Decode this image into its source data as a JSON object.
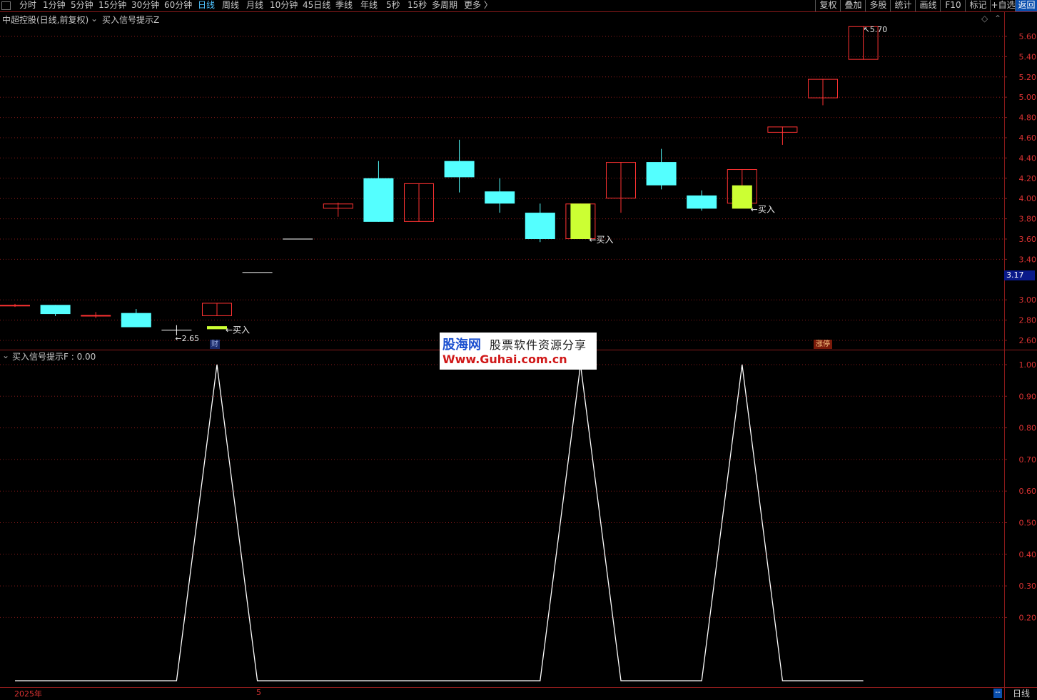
{
  "toolbar": {
    "periods": [
      {
        "label": "分时",
        "x": 27
      },
      {
        "label": "1分钟",
        "x": 60
      },
      {
        "label": "5分钟",
        "x": 99
      },
      {
        "label": "15分钟",
        "x": 138
      },
      {
        "label": "30分钟",
        "x": 184
      },
      {
        "label": "60分钟",
        "x": 230
      },
      {
        "label": "日线",
        "x": 277,
        "active": true
      },
      {
        "label": "周线",
        "x": 311
      },
      {
        "label": "月线",
        "x": 345
      },
      {
        "label": "10分钟",
        "x": 378
      },
      {
        "label": "45日线",
        "x": 424
      },
      {
        "label": "季线",
        "x": 470
      },
      {
        "label": "年线",
        "x": 505
      },
      {
        "label": "5秒",
        "x": 541
      },
      {
        "label": "15秒",
        "x": 571
      },
      {
        "label": "多周期",
        "x": 605
      },
      {
        "label": "更多 〉",
        "x": 650
      }
    ],
    "right_buttons": [
      "复权",
      "叠加",
      "多股",
      "统计",
      "画线",
      "F10",
      "标记",
      "+自选",
      "返回"
    ]
  },
  "main_chart": {
    "stock_title": "中超控股(日线,前复权)",
    "indicator_title": "买入信号提示Z",
    "y_ticks": [
      "5.60",
      "5.40",
      "5.20",
      "5.00",
      "4.80",
      "4.60",
      "4.40",
      "4.20",
      "4.00",
      "3.80",
      "3.60",
      "3.40",
      "3.00",
      "2.80",
      "2.60"
    ],
    "y_tick_values": [
      5.6,
      5.4,
      5.2,
      5.0,
      4.8,
      4.6,
      4.4,
      4.2,
      4.0,
      3.8,
      3.6,
      3.4,
      3.0,
      2.8,
      2.6
    ],
    "current_price": "3.17",
    "high_label": "5.70",
    "low_label": "2.65",
    "buy_label": "买入",
    "badge_cai": "财",
    "badge_zhangting": "涨停",
    "candles": [
      {
        "o": 2.95,
        "c": 2.94,
        "h": 2.96,
        "l": 2.93,
        "type": "up"
      },
      {
        "o": 2.95,
        "c": 2.86,
        "h": 2.95,
        "l": 2.84,
        "type": "down"
      },
      {
        "o": 2.85,
        "c": 2.84,
        "h": 2.88,
        "l": 2.82,
        "type": "up"
      },
      {
        "o": 2.87,
        "c": 2.73,
        "h": 2.91,
        "l": 2.73,
        "type": "down"
      },
      {
        "o": 2.7,
        "c": 2.7,
        "h": 2.75,
        "l": 2.65,
        "type": "flat"
      },
      {
        "o": 2.84,
        "c": 2.97,
        "h": 2.97,
        "l": 2.84,
        "type": "up",
        "signal": {
          "o": 2.71,
          "c": 2.74
        }
      },
      {
        "o": 3.27,
        "c": 3.27,
        "h": 3.27,
        "l": 3.27,
        "type": "flat"
      },
      {
        "o": 3.6,
        "c": 3.6,
        "h": 3.6,
        "l": 3.6,
        "type": "flat"
      },
      {
        "o": 3.9,
        "c": 3.95,
        "h": 3.96,
        "l": 3.82,
        "type": "up"
      },
      {
        "o": 4.2,
        "c": 3.77,
        "h": 4.37,
        "l": 3.77,
        "type": "down"
      },
      {
        "o": 3.77,
        "c": 4.15,
        "h": 4.15,
        "l": 3.77,
        "type": "up"
      },
      {
        "o": 4.37,
        "c": 4.21,
        "h": 4.58,
        "l": 4.06,
        "type": "down"
      },
      {
        "o": 4.07,
        "c": 3.95,
        "h": 4.2,
        "l": 3.86,
        "type": "down"
      },
      {
        "o": 3.86,
        "c": 3.6,
        "h": 3.95,
        "l": 3.57,
        "type": "down"
      },
      {
        "o": 3.6,
        "c": 3.95,
        "h": 3.95,
        "l": 3.6,
        "type": "up",
        "signal": {
          "o": 3.95,
          "c": 3.6
        }
      },
      {
        "o": 4.0,
        "c": 4.36,
        "h": 4.36,
        "l": 3.86,
        "type": "up"
      },
      {
        "o": 4.36,
        "c": 4.13,
        "h": 4.49,
        "l": 4.09,
        "type": "down"
      },
      {
        "o": 4.03,
        "c": 3.9,
        "h": 4.08,
        "l": 3.88,
        "type": "down"
      },
      {
        "o": 3.95,
        "c": 4.29,
        "h": 4.29,
        "l": 3.95,
        "type": "up",
        "signal": {
          "o": 4.13,
          "c": 3.9
        }
      },
      {
        "o": 4.65,
        "c": 4.71,
        "h": 4.71,
        "l": 4.53,
        "type": "up"
      },
      {
        "o": 4.99,
        "c": 5.18,
        "h": 5.18,
        "l": 4.92,
        "type": "up"
      },
      {
        "o": 5.37,
        "c": 5.7,
        "h": 5.7,
        "l": 5.37,
        "type": "up"
      }
    ]
  },
  "sub_chart": {
    "title": "买入信号提示F : 0.00",
    "y_ticks": [
      "1.00",
      "0.90",
      "0.80",
      "0.70",
      "0.60",
      "0.50",
      "0.40",
      "0.30",
      "0.20"
    ],
    "y_tick_values": [
      1.0,
      0.9,
      0.8,
      0.7,
      0.6,
      0.5,
      0.4,
      0.3,
      0.2
    ]
  },
  "chart_data": {
    "type": "line",
    "title": "买入信号提示F : 0.00",
    "x": [
      1,
      2,
      3,
      4,
      5,
      6,
      7,
      8,
      9,
      10,
      11,
      12,
      13,
      14,
      15,
      16,
      17,
      18,
      19,
      20,
      21,
      22
    ],
    "series": [
      {
        "name": "买入信号提示F",
        "values": [
          0,
          0,
          0,
          0,
          0,
          1,
          0,
          0,
          0,
          0,
          0,
          0,
          0,
          0,
          1,
          0,
          0,
          0,
          1,
          0,
          0,
          0
        ]
      }
    ],
    "ylim": [
      0,
      1.0
    ]
  },
  "footer": {
    "year": "2025年",
    "month": "5",
    "period": "日线",
    "btn": "--"
  },
  "watermark": {
    "line1a": "股海网",
    "line1b": "股票软件资源分享",
    "line2": "Www.Guhai.com.cn"
  },
  "colors": {
    "up": "#ff3232",
    "down": "#54ffff",
    "signal": "#ccff33",
    "grid": "#8a1a1a",
    "axis_text": "#d33"
  }
}
